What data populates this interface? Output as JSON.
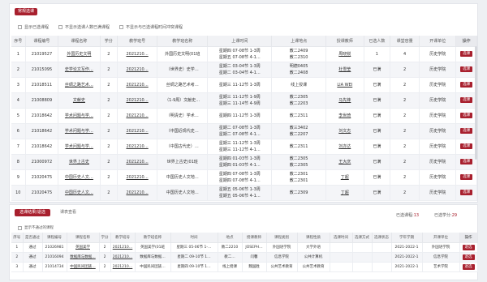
{
  "top": {
    "tab_label": "常规选课",
    "filters": [
      "显示已选课程",
      "不显示选课人数已满课程",
      "不显示与已选课程时间冲突课程"
    ],
    "columns": [
      "序号",
      "课程编号",
      "课程名称",
      "学分",
      "教学班号",
      "教学班名称",
      "上课时间",
      "上课地点",
      "授课教师",
      "已选人数",
      "课堂容量",
      "开课单位",
      "操作"
    ],
    "rows": [
      {
        "no": "1",
        "code": "21019527",
        "name": "外国历史文明",
        "credit": "2",
        "cls": "2021210…",
        "cls_name": "外国历史文明(01班",
        "time": [
          "星期四 07-08节 1-3周",
          "星期五 07-08节 4-1…"
        ],
        "place": [
          "教二2409",
          "教二2310"
        ],
        "teacher": "周晓锐",
        "sel": "1",
        "cap": "4",
        "dept": "历史学院",
        "action": "选课"
      },
      {
        "no": "2",
        "code": "21015095",
        "name": "史学论文写作…",
        "credit": "2",
        "cls": "2021210…",
        "cls_name": "（世界史）史学…",
        "time": [
          "星期二 03-04节 1-3周",
          "星期二 03-04节 4-1…"
        ],
        "place": [
          "明德0405",
          "教二2408"
        ],
        "teacher": "杜雪莹",
        "sel": "已满",
        "cap": "2",
        "dept": "历史学院",
        "action": "选课"
      },
      {
        "no": "3",
        "code": "21018511",
        "name": "丝绸之路艺术…",
        "credit": "2",
        "cls": "2021210…",
        "cls_name": "丝绸之路艺术考…",
        "time": [
          "星期三 11-12节 1-3周",
          ""
        ],
        "place": [
          "线上授课",
          ""
        ],
        "teacher": "LIA WEI",
        "sel": "已满",
        "cap": "2",
        "dept": "历史学院",
        "action": "选课"
      },
      {
        "no": "4",
        "code": "21008809",
        "name": "文献史",
        "credit": "2",
        "cls": "2021210…",
        "cls_name": "（1-9周）文献史…",
        "time": [
          "星期三 11-12节 1-9周",
          "星期三 11-14节 4-9周"
        ],
        "place": [
          "教二2305",
          "教二2203"
        ],
        "teacher": "马先锋",
        "sel": "已满",
        "cap": "2",
        "dept": "历史学院",
        "action": "选课"
      },
      {
        "no": "5",
        "code": "21018642",
        "name": "学术问题与学…",
        "credit": "2",
        "cls": "2021210…",
        "cls_name": "（明清史）学术…",
        "time": [
          "星期四 11-12节 1-3周",
          ""
        ],
        "place": [
          "教二2311",
          ""
        ],
        "teacher": "李世琦",
        "sel": "已满",
        "cap": "2",
        "dept": "历史学院",
        "action": "选课"
      },
      {
        "no": "6",
        "code": "21018642",
        "name": "学术问题与学…",
        "credit": "2",
        "cls": "2021210…",
        "cls_name": "（中国近现代史…",
        "time": [
          "星期二 07-08节 1-3周",
          "星期二 07-08节 4-1…"
        ],
        "place": [
          "教三3402",
          "教二2207"
        ],
        "teacher": "刘文志",
        "sel": "已满",
        "cap": "2",
        "dept": "历史学院",
        "action": "选课"
      },
      {
        "no": "7",
        "code": "21018642",
        "name": "学术问题与学…",
        "credit": "2",
        "cls": "2021210…",
        "cls_name": "（中国古代史）…",
        "time": [
          "星期三 11-12节 1-3周",
          "星期三 11-12节 4-1…"
        ],
        "place": [
          "教二2311",
          ""
        ],
        "teacher": "刘亦达",
        "sel": "已满",
        "cap": "2",
        "dept": "历史学院",
        "action": "选课"
      },
      {
        "no": "8",
        "code": "21000972",
        "name": "世界上古史",
        "credit": "2",
        "cls": "2021210…",
        "cls_name": "世界上古史(01班",
        "time": [
          "星期四 01-03节 1-3周",
          "星期四 01-03节 4-1…"
        ],
        "place": [
          "教二2305",
          "教二2305"
        ],
        "teacher": "王大庆",
        "sel": "已满",
        "cap": "2",
        "dept": "历史学院",
        "action": "选课"
      },
      {
        "no": "9",
        "code": "21020475",
        "name": "中国历史人文…",
        "credit": "2",
        "cls": "2021210…",
        "cls_name": "中国历史人文地…",
        "time": [
          "星期四 07-08节 1-3周",
          "星期四 07-08节 4-1…"
        ],
        "place": [
          "教二2301",
          "教二2301"
        ],
        "teacher": "丁超",
        "sel": "已满",
        "cap": "2",
        "dept": "历史学院",
        "action": "选课"
      },
      {
        "no": "10",
        "code": "21020475",
        "name": "中国历史人文…",
        "credit": "2",
        "cls": "2021210…",
        "cls_name": "中国历史人文地…",
        "time": [
          "星期五 05-06节 1-3周",
          "星期五 05-06节 4-1…"
        ],
        "place": [
          "教二2309",
          ""
        ],
        "teacher": "丁超",
        "sel": "已满",
        "cap": "2",
        "dept": "历史学院",
        "action": "选课"
      }
    ]
  },
  "bottom": {
    "tab_active": "选课结果/退选",
    "tab_other": "课表查看",
    "summary_courses_label": "已选课程:",
    "summary_courses_value": "13",
    "summary_credits_label": "已选学分:",
    "summary_credits_value": "29",
    "checkbox_label": "显示不通过的课程",
    "columns": [
      "序号",
      "是否通过",
      "课程编号",
      "课程名称",
      "学分",
      "教学班号",
      "教学班名称",
      "时间",
      "地点",
      "授课教师",
      "课程类别",
      "课程性质",
      "选课时间",
      "选课方式",
      "选课状态",
      "学年学期",
      "开课单位",
      "操作"
    ],
    "rows": [
      {
        "no": "1",
        "pass": "通过",
        "code": "21026981",
        "name": "英国美学",
        "credit": "2",
        "cls": "2021210…",
        "cls_name": "英国美学(01班",
        "time": "星期三 05-06节 1-…",
        "place": "教二2210",
        "teacher": "JOSEPH…",
        "cat": "外国语学院",
        "nature": "大学外语",
        "sel_time": "",
        "way": "",
        "status": "",
        "term": "2021-2022-1",
        "dept": "外国语学院",
        "action": "退选"
      },
      {
        "no": "2",
        "pass": "通过",
        "code": "21016094",
        "name": "数据库与数据…",
        "credit": "2",
        "cls": "2021210…",
        "cls_name": "数据库与数据…",
        "time": "星期二 09-10节 1…",
        "place": "教二…",
        "teacher": "闫馨",
        "cat": "信息学院",
        "nature": "公共计算机",
        "sel_time": "",
        "way": "",
        "status": "",
        "term": "2021-2022-1",
        "dept": "信息学院",
        "action": "退选"
      },
      {
        "no": "3",
        "pass": "通过",
        "code": "21014734",
        "name": "中国民间团族…",
        "credit": "2",
        "cls": "2021210…",
        "cls_name": "中国民间团族…",
        "time": "星期四 09-10节 1…",
        "place": "线上授课",
        "teacher": "魏国胜",
        "cat": "公共艺术教育",
        "nature": "公共艺术教育",
        "sel_time": "",
        "way": "",
        "status": "",
        "term": "2021-2022-1",
        "dept": "艺术学院",
        "action": "退选"
      }
    ]
  }
}
